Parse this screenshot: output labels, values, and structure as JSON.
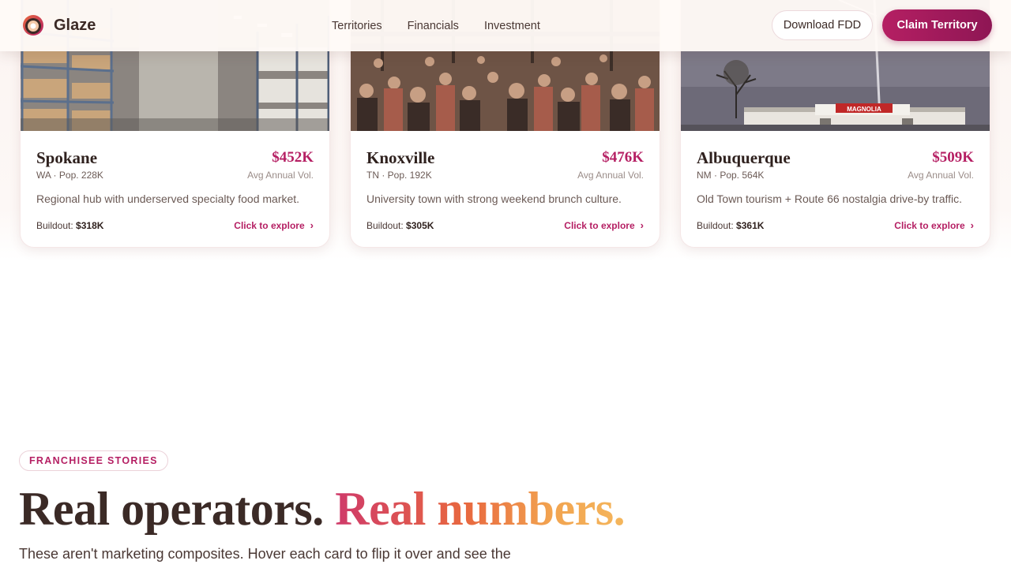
{
  "header": {
    "brand": "Glaze",
    "nav": [
      "Territories",
      "Financials",
      "Investment"
    ],
    "download_label": "Download FDD",
    "claim_label": "Claim Territory"
  },
  "colors": {
    "accent": "#b51f63",
    "text": "#3b2a26"
  },
  "cards": [
    {
      "city": "Spokane",
      "meta": "WA · Pop. 228K",
      "price": "$452K",
      "price_label": "Avg Annual Vol.",
      "desc": "Regional hub with underserved specialty food market.",
      "buildout_label": "Buildout:",
      "buildout_value": "$318K",
      "cta": "Click to explore",
      "image": "warehouse shelves interior"
    },
    {
      "city": "Knoxville",
      "meta": "TN · Pop. 192K",
      "price": "$476K",
      "price_label": "Avg Annual Vol.",
      "desc": "University town with strong weekend brunch culture.",
      "buildout_label": "Buildout:",
      "buildout_value": "$305K",
      "cta": "Click to explore",
      "image": "crowded outdoor market"
    },
    {
      "city": "Albuquerque",
      "meta": "NM · Pop. 564K",
      "price": "$509K",
      "price_label": "Avg Annual Vol.",
      "desc": "Old Town tourism + Route 66 nostalgia drive-by traffic.",
      "buildout_label": "Buildout:",
      "buildout_value": "$361K",
      "cta": "Click to explore",
      "image": "roadside station with MAGNOLIA sign",
      "sign_text": "MAGNOLIA"
    }
  ],
  "stories": {
    "pill": "FRANCHISEE STORIES",
    "headline_a": "Real operators.",
    "headline_b": "Real numbers.",
    "lead": "These aren't marketing composites. Hover each card to flip it over and see the"
  }
}
